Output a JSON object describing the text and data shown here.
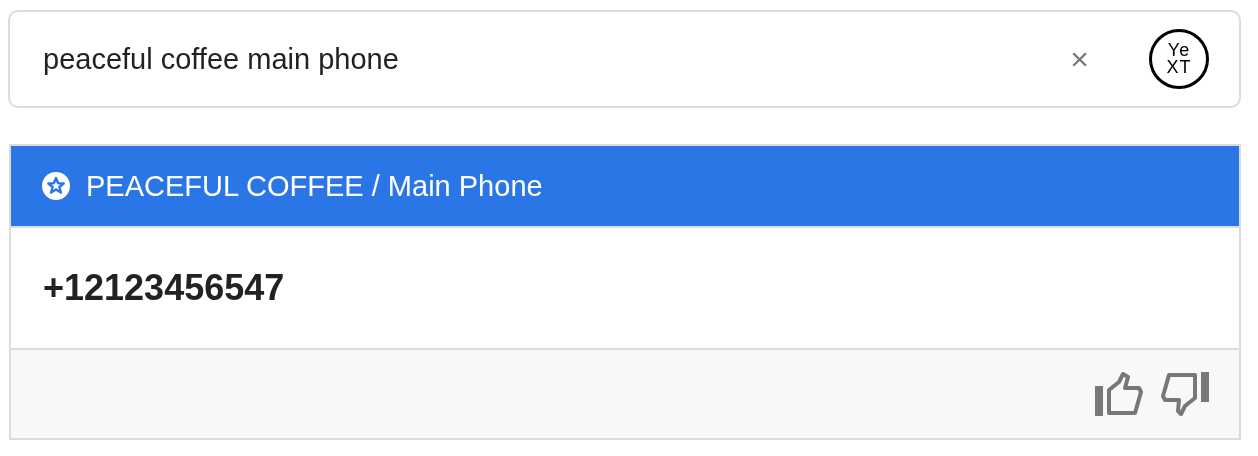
{
  "search": {
    "value": "peaceful coffee main phone",
    "clear": "×",
    "logo": [
      "Ye",
      "XT"
    ]
  },
  "answer": {
    "title": "PEACEFUL COFFEE / Main Phone",
    "value": "+12123456547"
  }
}
